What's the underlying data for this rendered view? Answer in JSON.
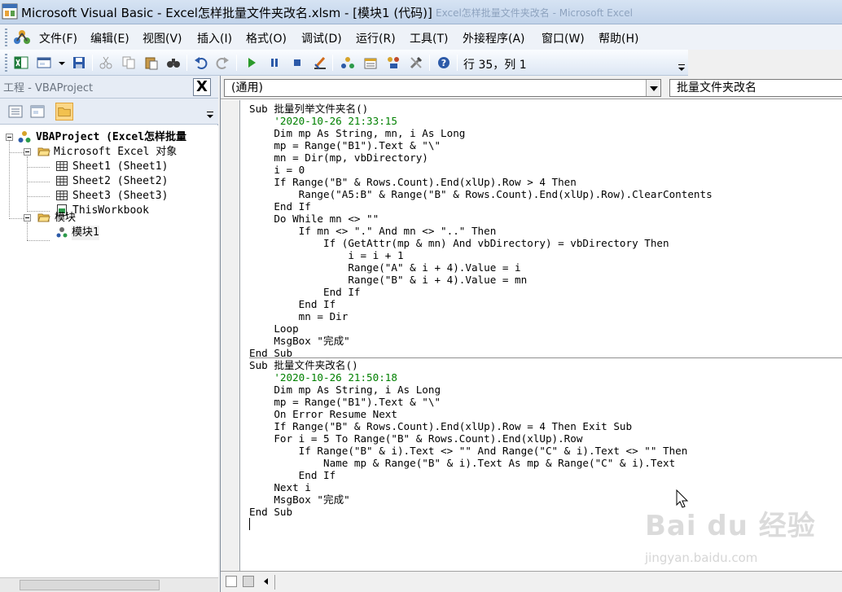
{
  "window": {
    "title": "Microsoft Visual Basic - Excel怎样批量文件夹改名.xlsm - [模块1 (代码)]",
    "background_title": "Excel怎样批量文件夹改名 - Microsoft Excel"
  },
  "menu": {
    "items": [
      "文件(F)",
      "编辑(E)",
      "视图(V)",
      "插入(I)",
      "格式(O)",
      "调试(D)",
      "运行(R)",
      "工具(T)",
      "外接程序(A)",
      "窗口(W)",
      "帮助(H)"
    ]
  },
  "toolbar": {
    "cursor_position": "行 35，列 1"
  },
  "project": {
    "title": "工程 - VBAProject",
    "close_label": "X",
    "tree": {
      "root": "VBAProject (Excel怎样批量",
      "excel_objects": "Microsoft Excel 对象",
      "sheets": [
        "Sheet1 (Sheet1)",
        "Sheet2 (Sheet2)",
        "Sheet3 (Sheet3)"
      ],
      "workbook": "ThisWorkbook",
      "modules_folder": "模块",
      "module": "模块1"
    }
  },
  "code": {
    "object_combo": "(通用)",
    "procedure_combo": "批量文件夹改名",
    "procedures": [
      {
        "lines": [
          "Sub 批量列举文件夹名()",
          "    '2020-10-26 21:33:15",
          "    Dim mp As String, mn, i As Long",
          "    mp = Range(\"B1\").Text & \"\\\"",
          "    mn = Dir(mp, vbDirectory)",
          "    i = 0",
          "    If Range(\"B\" & Rows.Count).End(xlUp).Row > 4 Then",
          "        Range(\"A5:B\" & Range(\"B\" & Rows.Count).End(xlUp).Row).ClearContents",
          "    End If",
          "    Do While mn <> \"\"",
          "        If mn <> \".\" And mn <> \"..\" Then",
          "            If (GetAttr(mp & mn) And vbDirectory) = vbDirectory Then",
          "                i = i + 1",
          "                Range(\"A\" & i + 4).Value = i",
          "                Range(\"B\" & i + 4).Value = mn",
          "            End If",
          "        End If",
          "        mn = Dir",
          "    Loop",
          "    MsgBox \"完成\"",
          "End Sub"
        ]
      },
      {
        "lines": [
          "Sub 批量文件夹改名()",
          "    '2020-10-26 21:50:18",
          "    Dim mp As String, i As Long",
          "    mp = Range(\"B1\").Text & \"\\\"",
          "    On Error Resume Next",
          "    If Range(\"B\" & Rows.Count).End(xlUp).Row = 4 Then Exit Sub",
          "    For i = 5 To Range(\"B\" & Rows.Count).End(xlUp).Row",
          "        If Range(\"B\" & i).Text <> \"\" And Range(\"C\" & i).Text <> \"\" Then",
          "            Name mp & Range(\"B\" & i).Text As mp & Range(\"C\" & i).Text",
          "        End If",
          "    Next i",
          "    MsgBox \"完成\"",
          "End Sub"
        ]
      }
    ]
  },
  "watermark": {
    "main": "Bai du 经验",
    "sub": "jingyan.baidu.com"
  }
}
